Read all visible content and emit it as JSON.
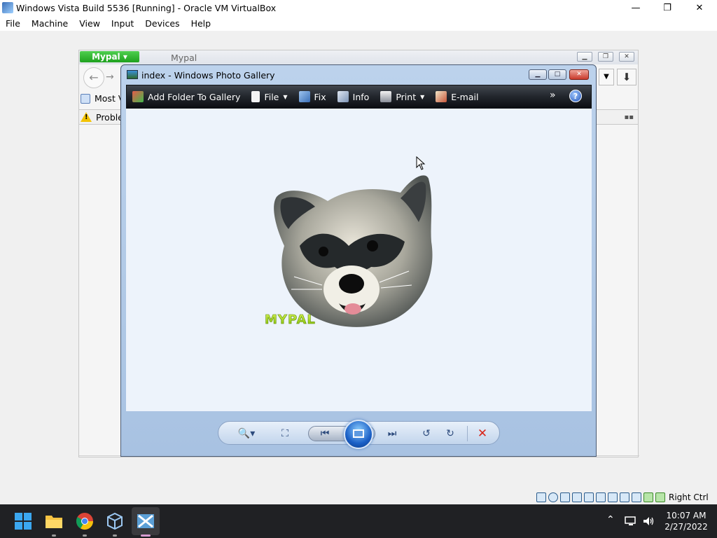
{
  "host": {
    "title": "Windows Vista Build 5536 [Running] - Oracle VM VirtualBox",
    "minimize": "—",
    "restore": "❐",
    "close": "✕",
    "menu": [
      "File",
      "Machine",
      "View",
      "Input",
      "Devices",
      "Help"
    ],
    "host_key": "Right Ctrl"
  },
  "mypal": {
    "brand": "Mypal ▾",
    "title": "Mypal",
    "bookmark": "Most V",
    "notification": "Probler"
  },
  "gallery": {
    "title": "index - Windows Photo Gallery",
    "toolbar": {
      "add_folder": "Add Folder To Gallery",
      "file": "File",
      "fix": "Fix",
      "info": "Info",
      "print": "Print",
      "email": "E-mail",
      "more": "»",
      "help": "?"
    },
    "image_text": "MYPAL"
  },
  "taskbar": {
    "time": "10:07 AM",
    "date": "2/27/2022"
  },
  "colors": {
    "mypal_green": "#1ea11e",
    "gallery_toolbar": "#22262c",
    "taskbar_bg": "#202124"
  }
}
